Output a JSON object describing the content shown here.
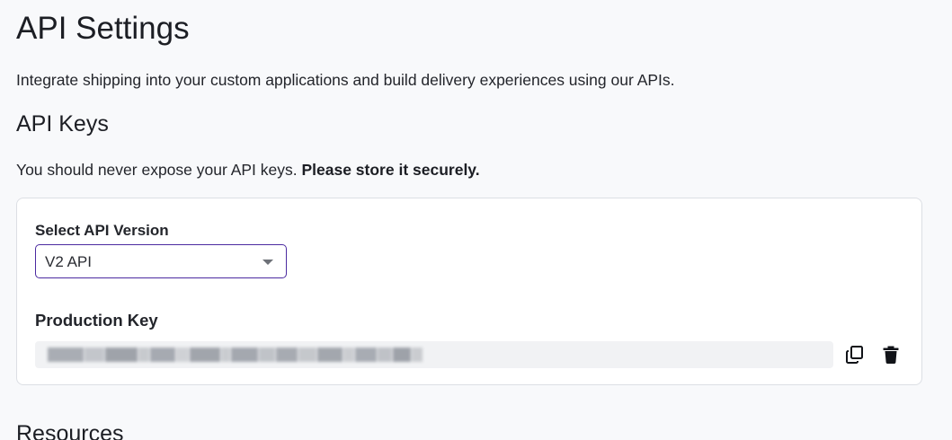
{
  "page": {
    "title": "API Settings",
    "intro": "Integrate shipping into your custom applications and build delivery experiences using our APIs."
  },
  "api_keys": {
    "title": "API Keys",
    "warning_text": "You should never expose your API keys.",
    "warning_strong": "Please store it securely.",
    "version_label": "Select API Version",
    "version_value": "V2 API",
    "production_label": "Production Key",
    "production_value": "",
    "copy_icon": "copy-icon",
    "delete_icon": "trash-icon"
  },
  "resources": {
    "title": "Resources"
  },
  "colors": {
    "select_border": "#4b2aa0",
    "background": "#f8f9fb",
    "key_field_bg": "#f1f2f4"
  }
}
